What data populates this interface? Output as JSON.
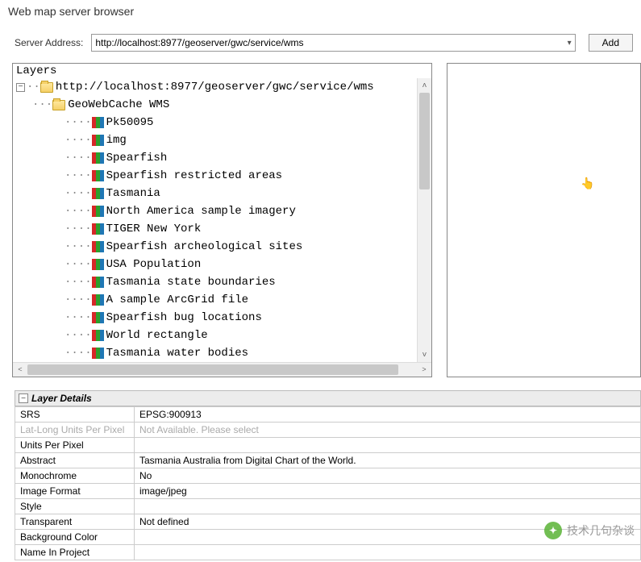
{
  "window": {
    "title": "Web map server browser"
  },
  "address": {
    "label": "Server Address:",
    "value": "http://localhost:8977/geoserver/gwc/service/wms",
    "add_label": "Add"
  },
  "layers": {
    "header": "Layers",
    "root": "http://localhost:8977/geoserver/gwc/service/wms",
    "service": "GeoWebCache WMS",
    "items": [
      "Pk50095",
      "img",
      "Spearfish",
      "Spearfish restricted areas",
      "Tasmania",
      "North America sample imagery",
      "TIGER New York",
      "Spearfish archeological sites",
      "USA Population",
      "Tasmania state boundaries",
      "A sample ArcGrid file",
      "Spearfish bug locations",
      "World rectangle",
      "Tasmania water bodies"
    ]
  },
  "details": {
    "title": "Layer Details",
    "rows": [
      {
        "key": "SRS",
        "value": "EPSG:900913",
        "disabled": false
      },
      {
        "key": "Lat-Long Units Per Pixel",
        "value": "Not Available. Please select",
        "disabled": true
      },
      {
        "key": "Units Per Pixel",
        "value": "",
        "disabled": false
      },
      {
        "key": "Abstract",
        "value": "Tasmania Australia from Digital Chart of the World.",
        "disabled": false
      },
      {
        "key": "Monochrome",
        "value": "No",
        "disabled": false
      },
      {
        "key": "Image Format",
        "value": "image/jpeg",
        "disabled": false
      },
      {
        "key": "Style",
        "value": "",
        "disabled": false
      },
      {
        "key": "Transparent",
        "value": "Not defined",
        "disabled": false
      },
      {
        "key": "Background Color",
        "value": "",
        "disabled": false
      },
      {
        "key": "Name In Project",
        "value": "",
        "disabled": false
      }
    ]
  },
  "watermark": {
    "text": "技术几句杂谈"
  }
}
